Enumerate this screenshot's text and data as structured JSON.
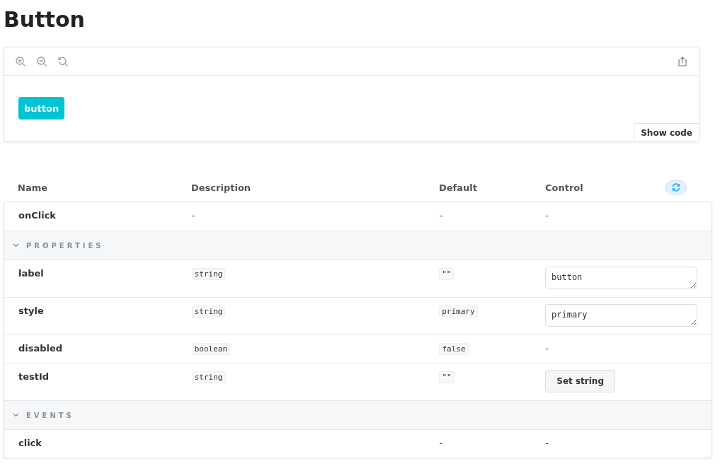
{
  "title": "Button",
  "preview": {
    "button_label": "button",
    "show_code": "Show code"
  },
  "table": {
    "columns": [
      "Name",
      "Description",
      "Default",
      "Control"
    ],
    "rows": [
      {
        "kind": "row",
        "name": "onClick",
        "description": {
          "kind": "plain",
          "text": "-"
        },
        "default": {
          "kind": "plain",
          "text": "-"
        },
        "control": {
          "kind": "plain",
          "text": "-"
        }
      },
      {
        "kind": "section",
        "name": "PROPERTIES",
        "expanded": true
      },
      {
        "kind": "row",
        "name": "label",
        "description": {
          "kind": "code",
          "text": "string"
        },
        "default": {
          "kind": "code",
          "text": "\"\""
        },
        "control": {
          "kind": "textarea",
          "text": "button"
        }
      },
      {
        "kind": "row",
        "name": "style",
        "description": {
          "kind": "code",
          "text": "string"
        },
        "default": {
          "kind": "code",
          "text": "primary"
        },
        "control": {
          "kind": "textarea",
          "text": "primary"
        }
      },
      {
        "kind": "row",
        "name": "disabled",
        "description": {
          "kind": "code",
          "text": "boolean"
        },
        "default": {
          "kind": "code",
          "text": "false"
        },
        "control": {
          "kind": "plain",
          "text": "-"
        }
      },
      {
        "kind": "row",
        "name": "testId",
        "description": {
          "kind": "code",
          "text": "string"
        },
        "default": {
          "kind": "code",
          "text": "\"\""
        },
        "control": {
          "kind": "button",
          "text": "Set string"
        }
      },
      {
        "kind": "section",
        "name": "EVENTS",
        "expanded": true
      },
      {
        "kind": "row",
        "name": "click",
        "default": {
          "kind": "plain",
          "text": "-"
        },
        "control": {
          "kind": "plain",
          "text": "-"
        }
      }
    ]
  }
}
